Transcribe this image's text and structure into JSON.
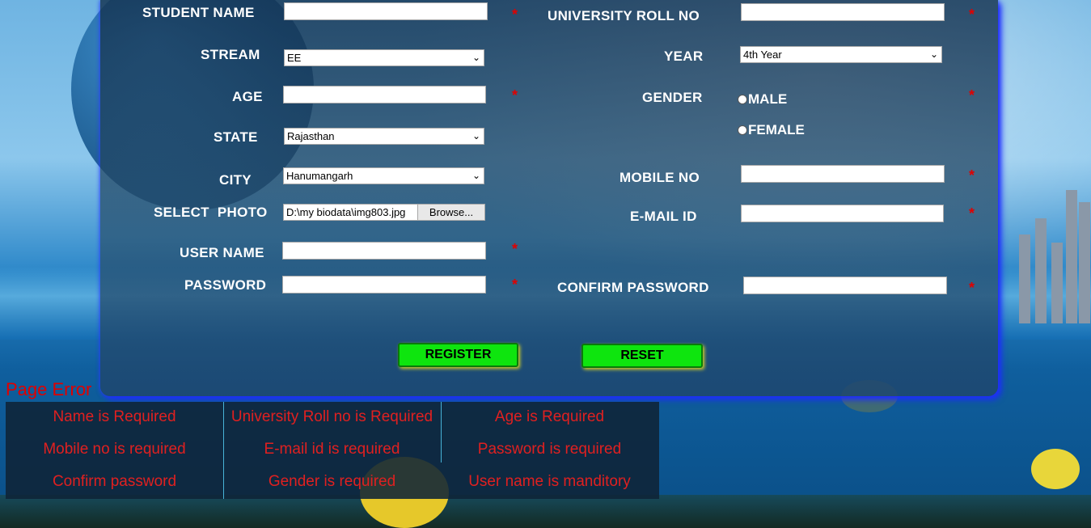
{
  "form": {
    "student_name_label": "STUDENT NAME",
    "stream_label": "STREAM",
    "stream_value": "EE",
    "age_label": "AGE",
    "state_label": "STATE",
    "state_value": "Rajasthan",
    "city_label": "CITY",
    "city_value": "Hanumangarh",
    "photo_label": "SELECT  PHOTO",
    "photo_path": "D:\\my biodata\\img803.jpg",
    "browse_label": "Browse...",
    "username_label": "USER NAME",
    "password_label": "PASSWORD",
    "roll_label": "UNIVERSITY ROLL NO",
    "year_label": "YEAR",
    "year_value": "4th Year",
    "gender_label": "GENDER",
    "gender_male": "MALE",
    "gender_female": "FEMALE",
    "mobile_label": "MOBILE NO",
    "email_label": "E-MAIL ID",
    "confirm_label": "CONFIRM PASSWORD",
    "required_mark": "*",
    "register_label": "REGISTER",
    "reset_label": "RESET"
  },
  "errors": {
    "title": "Page Error",
    "row1": [
      "Name is Required",
      "University Roll no is Required",
      "Age is Required"
    ],
    "row2": [
      "Mobile no is required",
      "E-mail id is required",
      "Password is required"
    ],
    "row3": [
      "Confirm password",
      "Gender is required",
      "User name is manditory"
    ]
  },
  "colors": {
    "required": "#e00000",
    "button": "#0ee50e",
    "panel_glow": "#1d2bff",
    "error_text": "#e02020"
  }
}
